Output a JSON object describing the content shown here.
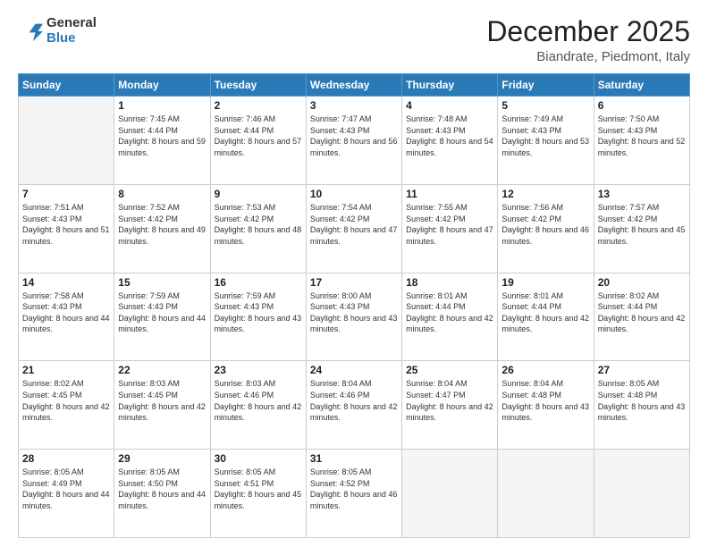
{
  "logo": {
    "general": "General",
    "blue": "Blue"
  },
  "title": "December 2025",
  "location": "Biandrate, Piedmont, Italy",
  "weekdays": [
    "Sunday",
    "Monday",
    "Tuesday",
    "Wednesday",
    "Thursday",
    "Friday",
    "Saturday"
  ],
  "weeks": [
    [
      {
        "day": "",
        "empty": true
      },
      {
        "day": "1",
        "sunrise": "7:45 AM",
        "sunset": "4:44 PM",
        "daylight": "8 hours and 59 minutes."
      },
      {
        "day": "2",
        "sunrise": "7:46 AM",
        "sunset": "4:44 PM",
        "daylight": "8 hours and 57 minutes."
      },
      {
        "day": "3",
        "sunrise": "7:47 AM",
        "sunset": "4:43 PM",
        "daylight": "8 hours and 56 minutes."
      },
      {
        "day": "4",
        "sunrise": "7:48 AM",
        "sunset": "4:43 PM",
        "daylight": "8 hours and 54 minutes."
      },
      {
        "day": "5",
        "sunrise": "7:49 AM",
        "sunset": "4:43 PM",
        "daylight": "8 hours and 53 minutes."
      },
      {
        "day": "6",
        "sunrise": "7:50 AM",
        "sunset": "4:43 PM",
        "daylight": "8 hours and 52 minutes."
      }
    ],
    [
      {
        "day": "7",
        "sunrise": "7:51 AM",
        "sunset": "4:43 PM",
        "daylight": "8 hours and 51 minutes."
      },
      {
        "day": "8",
        "sunrise": "7:52 AM",
        "sunset": "4:42 PM",
        "daylight": "8 hours and 49 minutes."
      },
      {
        "day": "9",
        "sunrise": "7:53 AM",
        "sunset": "4:42 PM",
        "daylight": "8 hours and 48 minutes."
      },
      {
        "day": "10",
        "sunrise": "7:54 AM",
        "sunset": "4:42 PM",
        "daylight": "8 hours and 47 minutes."
      },
      {
        "day": "11",
        "sunrise": "7:55 AM",
        "sunset": "4:42 PM",
        "daylight": "8 hours and 47 minutes."
      },
      {
        "day": "12",
        "sunrise": "7:56 AM",
        "sunset": "4:42 PM",
        "daylight": "8 hours and 46 minutes."
      },
      {
        "day": "13",
        "sunrise": "7:57 AM",
        "sunset": "4:42 PM",
        "daylight": "8 hours and 45 minutes."
      }
    ],
    [
      {
        "day": "14",
        "sunrise": "7:58 AM",
        "sunset": "4:43 PM",
        "daylight": "8 hours and 44 minutes."
      },
      {
        "day": "15",
        "sunrise": "7:59 AM",
        "sunset": "4:43 PM",
        "daylight": "8 hours and 44 minutes."
      },
      {
        "day": "16",
        "sunrise": "7:59 AM",
        "sunset": "4:43 PM",
        "daylight": "8 hours and 43 minutes."
      },
      {
        "day": "17",
        "sunrise": "8:00 AM",
        "sunset": "4:43 PM",
        "daylight": "8 hours and 43 minutes."
      },
      {
        "day": "18",
        "sunrise": "8:01 AM",
        "sunset": "4:44 PM",
        "daylight": "8 hours and 42 minutes."
      },
      {
        "day": "19",
        "sunrise": "8:01 AM",
        "sunset": "4:44 PM",
        "daylight": "8 hours and 42 minutes."
      },
      {
        "day": "20",
        "sunrise": "8:02 AM",
        "sunset": "4:44 PM",
        "daylight": "8 hours and 42 minutes."
      }
    ],
    [
      {
        "day": "21",
        "sunrise": "8:02 AM",
        "sunset": "4:45 PM",
        "daylight": "8 hours and 42 minutes."
      },
      {
        "day": "22",
        "sunrise": "8:03 AM",
        "sunset": "4:45 PM",
        "daylight": "8 hours and 42 minutes."
      },
      {
        "day": "23",
        "sunrise": "8:03 AM",
        "sunset": "4:46 PM",
        "daylight": "8 hours and 42 minutes."
      },
      {
        "day": "24",
        "sunrise": "8:04 AM",
        "sunset": "4:46 PM",
        "daylight": "8 hours and 42 minutes."
      },
      {
        "day": "25",
        "sunrise": "8:04 AM",
        "sunset": "4:47 PM",
        "daylight": "8 hours and 42 minutes."
      },
      {
        "day": "26",
        "sunrise": "8:04 AM",
        "sunset": "4:48 PM",
        "daylight": "8 hours and 43 minutes."
      },
      {
        "day": "27",
        "sunrise": "8:05 AM",
        "sunset": "4:48 PM",
        "daylight": "8 hours and 43 minutes."
      }
    ],
    [
      {
        "day": "28",
        "sunrise": "8:05 AM",
        "sunset": "4:49 PM",
        "daylight": "8 hours and 44 minutes."
      },
      {
        "day": "29",
        "sunrise": "8:05 AM",
        "sunset": "4:50 PM",
        "daylight": "8 hours and 44 minutes."
      },
      {
        "day": "30",
        "sunrise": "8:05 AM",
        "sunset": "4:51 PM",
        "daylight": "8 hours and 45 minutes."
      },
      {
        "day": "31",
        "sunrise": "8:05 AM",
        "sunset": "4:52 PM",
        "daylight": "8 hours and 46 minutes."
      },
      {
        "day": "",
        "empty": true
      },
      {
        "day": "",
        "empty": true
      },
      {
        "day": "",
        "empty": true
      }
    ]
  ]
}
